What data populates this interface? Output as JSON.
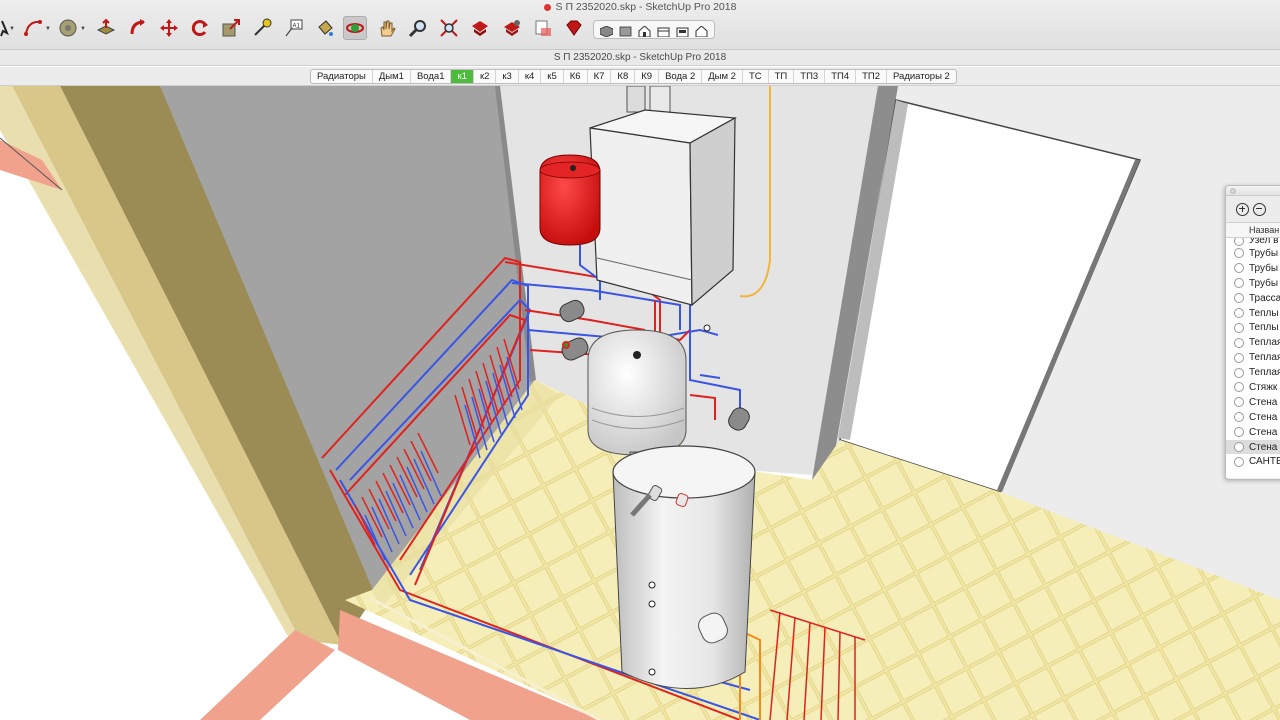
{
  "app": {
    "title": "S П 2352020.skp - SketchUp Pro 2018",
    "window_title": "S П 2352020.skp - SketchUp Pro 2018"
  },
  "toolbar": {
    "tools": [
      {
        "name": "select-icon"
      },
      {
        "name": "arc-icon"
      },
      {
        "name": "tape-measure-icon"
      },
      {
        "name": "push-pull-icon"
      },
      {
        "name": "follow-me-icon"
      },
      {
        "name": "move-icon"
      },
      {
        "name": "rotate-icon"
      },
      {
        "name": "scale-icon"
      },
      {
        "name": "tape-icon"
      },
      {
        "name": "text-icon"
      },
      {
        "name": "paint-bucket-icon"
      },
      {
        "name": "orbit-icon"
      },
      {
        "name": "pan-icon"
      },
      {
        "name": "zoom-icon"
      },
      {
        "name": "zoom-extents-icon"
      },
      {
        "name": "warehouse-icon"
      },
      {
        "name": "extension-warehouse-icon"
      },
      {
        "name": "layout-icon"
      },
      {
        "name": "ruby-gem-icon"
      }
    ],
    "views": [
      "iso-view-icon",
      "top-view-icon",
      "front-view-icon",
      "right-view-icon",
      "back-view-icon",
      "left-view-icon"
    ]
  },
  "scene_tabs": {
    "active": "к1",
    "items": [
      "Радиаторы",
      "Дым1",
      "Вода1",
      "к1",
      "к2",
      "к3",
      "к4",
      "к5",
      "К6",
      "К7",
      "К8",
      "К9",
      "Вода 2",
      "Дым 2",
      "ТС",
      "ТП",
      "ТП3",
      "ТП4",
      "ТП2",
      "Радиаторы 2"
    ]
  },
  "layers_panel": {
    "add_label": "+",
    "remove_label": "−",
    "column_header": "Назван",
    "partial_row": "Узел в",
    "rows": [
      "Трубы",
      "Трубы",
      "Трубы",
      "Трасса",
      "Теплы",
      "Теплы",
      "Теплая",
      "Теплая",
      "Теплая",
      "Стяжк",
      "Стена",
      "Стена",
      "Стена",
      "Стена",
      "САНТЕ"
    ],
    "selected_index": 13
  },
  "colors": {
    "hot_pipe": "#e0221f",
    "cold_pipe": "#3a55e6",
    "expansion_tank": "#e21818",
    "floor_tile": "#f0e6a6",
    "wall_gray": "#a3a3a3",
    "active_tab": "#4dbb3c"
  }
}
